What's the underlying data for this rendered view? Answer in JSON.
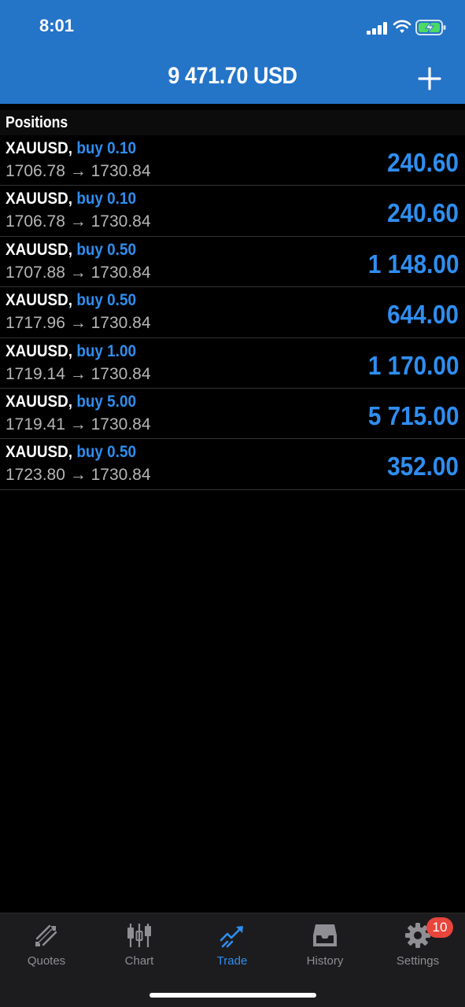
{
  "status_bar": {
    "time": "8:01"
  },
  "header": {
    "balance": "9 471.70 USD"
  },
  "section": {
    "title": "Positions"
  },
  "positions": [
    {
      "symbol": "XAUUSD,",
      "side": "buy 0.10",
      "open": "1706.78",
      "current": "1730.84",
      "profit": "240.60"
    },
    {
      "symbol": "XAUUSD,",
      "side": "buy 0.10",
      "open": "1706.78",
      "current": "1730.84",
      "profit": "240.60"
    },
    {
      "symbol": "XAUUSD,",
      "side": "buy 0.50",
      "open": "1707.88",
      "current": "1730.84",
      "profit": "1 148.00"
    },
    {
      "symbol": "XAUUSD,",
      "side": "buy 0.50",
      "open": "1717.96",
      "current": "1730.84",
      "profit": "644.00"
    },
    {
      "symbol": "XAUUSD,",
      "side": "buy 1.00",
      "open": "1719.14",
      "current": "1730.84",
      "profit": "1 170.00"
    },
    {
      "symbol": "XAUUSD,",
      "side": "buy 5.00",
      "open": "1719.41",
      "current": "1730.84",
      "profit": "5 715.00"
    },
    {
      "symbol": "XAUUSD,",
      "side": "buy 0.50",
      "open": "1723.80",
      "current": "1730.84",
      "profit": "352.00"
    }
  ],
  "arrow": "→",
  "tabbar": {
    "tabs": [
      {
        "label": "Quotes",
        "icon": "quotes-icon"
      },
      {
        "label": "Chart",
        "icon": "chart-icon"
      },
      {
        "label": "Trade",
        "icon": "trade-icon",
        "active": true
      },
      {
        "label": "History",
        "icon": "history-icon"
      },
      {
        "label": "Settings",
        "icon": "gear-icon"
      }
    ],
    "settings_badge": "10"
  },
  "colors": {
    "header_bg": "#2474c8",
    "accent": "#2f8ef0",
    "badge": "#e8453c"
  }
}
